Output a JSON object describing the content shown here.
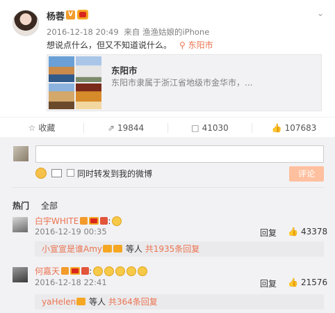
{
  "post": {
    "username": "杨蓉",
    "verified_badge": "V",
    "timestamp": "2016-12-18 20:49",
    "source": "来自 渔渔姑娘的iPhone",
    "text": "想说点什么，但又不知道说什么。",
    "location": "东阳市",
    "card": {
      "title": "东阳市",
      "description": "东阳市隶属于浙江省地级市金华市，..."
    }
  },
  "actions": {
    "favorite_label": "收藏",
    "repost_count": "19844",
    "comment_count": "41030",
    "like_count": "107683"
  },
  "composer": {
    "placeholder": "",
    "repost_label": "同时转发到我的微博",
    "submit_label": "评论"
  },
  "tabs": {
    "hot": "热门",
    "all": "全部"
  },
  "comments": [
    {
      "user": "白宇WHITE",
      "time": "2016-12-19 00:35",
      "reply_label": "回复",
      "likes": "43378",
      "subreply": {
        "user": "小宣宣是谁Amy",
        "suffix": "等人",
        "more": "共1935条回复"
      }
    },
    {
      "user": "何嘉天",
      "time": "2016-12-18 22:41",
      "reply_label": "回复",
      "likes": "21576",
      "subreply": {
        "user": "yaHelen",
        "suffix": "等人",
        "more": "共364条回复"
      }
    }
  ],
  "colors": {
    "accent": "#eb7350",
    "submit_disabled": "#ffc09f",
    "background_gray": "#f2f2f5"
  },
  "icons": [
    "chevron-down-icon",
    "location-icon",
    "star-icon",
    "repost-icon",
    "comment-icon",
    "thumbs-up-icon",
    "emoji-icon",
    "image-icon"
  ]
}
